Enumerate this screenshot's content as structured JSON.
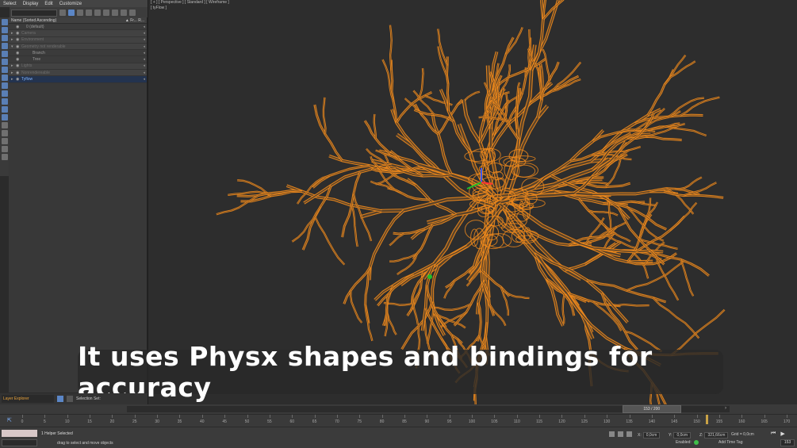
{
  "menu": [
    "Select",
    "Display",
    "Edit",
    "Customize"
  ],
  "explorer": {
    "header_name": "Name (Sorted Ascending)",
    "header_cols": "▲ Fr...   R...",
    "rows": [
      {
        "label": "0 (default)",
        "style": "normal"
      },
      {
        "label": "Camera",
        "style": "dim"
      },
      {
        "label": "Environment",
        "style": "dim"
      },
      {
        "label": "Geometry not renderable",
        "style": "dim"
      },
      {
        "label": "Branch",
        "style": "normal"
      },
      {
        "label": "Tree",
        "style": "normal"
      },
      {
        "label": "Lights",
        "style": "dim"
      },
      {
        "label": "Nonrendereable",
        "style": "dim"
      },
      {
        "label": "Tyflow",
        "style": "sel"
      }
    ]
  },
  "viewport": {
    "label": "[ + ] [ Perspective ] [ Standard ] [ Wireframe ]",
    "object_label": "[ tyFlow ]"
  },
  "caption": "It uses Physx shapes and bindings for accuracy",
  "layer_bar": {
    "layer_label": "Layer Explorer",
    "selection_label": "Selection Set:"
  },
  "time_slider": {
    "frame_label": "153 / 200",
    "current_fraction": 0.765
  },
  "ruler": {
    "ticks": [
      "0",
      "5",
      "10",
      "15",
      "20",
      "25",
      "30",
      "35",
      "40",
      "45",
      "50",
      "55",
      "60",
      "65",
      "70",
      "75",
      "80",
      "85",
      "90",
      "95",
      "100",
      "105",
      "110",
      "115",
      "120",
      "125",
      "130",
      "135",
      "140",
      "145",
      "150",
      "155",
      "160",
      "165",
      "170"
    ]
  },
  "status": {
    "selection": "1 Helper Selected",
    "prompt": "drag to select and move objects",
    "x_label": "X:",
    "x_value": "0,0cm",
    "y_label": "Y:",
    "y_value": "0,0cm",
    "z_label": "Z:",
    "z_value": "321,66cm",
    "grid": "Grid = 0,0cm",
    "enabled_label": "Enabled:",
    "add_time_tag": "Add Time Tag",
    "frame": "153"
  },
  "colors": {
    "wire": "#f08a1c",
    "accent": "#5b86c6",
    "highlight": "#7fb3ff"
  }
}
